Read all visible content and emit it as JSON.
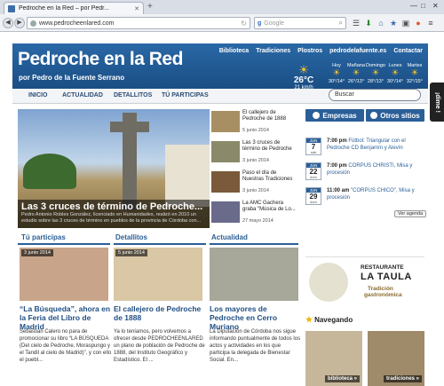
{
  "browser": {
    "tab_title": "Pedroche en la Red – por Pedr...",
    "url": "www.pedrocheenlared.com",
    "search_engine": "g",
    "search_placeholder": "Google"
  },
  "site": {
    "title": "Pedroche en la Red",
    "subtitle": "por Pedro de la Fuente Serrano",
    "top_links": [
      "Biblioteca",
      "Tradiciones",
      "Plostros",
      "pedrodelafuente.es",
      "Contactar"
    ],
    "weather": {
      "temp": "26°C",
      "wind": "21 km/h",
      "days": [
        {
          "day": "Hoy",
          "range": "30°/14°"
        },
        {
          "day": "Mañana",
          "range": "26°/13°"
        },
        {
          "day": "Domingo",
          "range": "28°/13°"
        },
        {
          "day": "Lunes",
          "range": "30°/14°"
        },
        {
          "day": "Martes",
          "range": "32°/15°"
        }
      ]
    },
    "menu": [
      "INICIO",
      "ACTUALIDAD",
      "DETALLITOS",
      "TÚ PARTICIPAS"
    ],
    "search_placeholder": "Buscar",
    "side_tab": "¡dime !"
  },
  "slider": {
    "title": "Las 3 cruces de término de Pedroche...",
    "desc": "Pedro Antonio Robles González, licenciado en Humanidades, realizó en 2010 un estudio sobre las 3 cruces de término en pueblos de la provincia de Córdoba con..."
  },
  "thumbs": [
    {
      "title": "El callejero de Pedroche de 1888",
      "date": "5 junio 2014"
    },
    {
      "title": "Las 3 cruces de término de Pedroche",
      "date": "3 junio 2014"
    },
    {
      "title": "Paso el día de Nuestras Tradiciones",
      "date": "3 junio 2014"
    },
    {
      "title": "La AMC Gachera graba \"Música de Lo...",
      "date": "27 mayo 2014"
    }
  ],
  "columns": [
    {
      "head": "Tú participas",
      "date": "3 junio 2014",
      "title": "“La Búsqueda”, ahora en la Feria del Libro de Madrid",
      "text": "Sebastián Calero no para de promocionar su libro “LA BÚSQUEDA (Del cielo de Pedroche, Moraspungo y el Tandil al cielo de Madrid)”, y con ello el puebl..."
    },
    {
      "head": "Detallitos",
      "date": "5 junio 2014",
      "title": "El callejero de Pedroche de 1888",
      "text": "Ya lo teníamos, pero volvemos a ofrecer desde PEDROCHEENLARED un plano de población de Pedroche de 1888, del Instituto Geográfico y Estadístico. El ..."
    },
    {
      "head": "Actualidad",
      "date": "",
      "title": "Los mayores de Pedroche en Cerro Muriano",
      "text": "La Diputación de Córdoba nos sigue informando puntualmente de todos los actos y actividades en los que participa la delegada de Bienestar Social. En..."
    }
  ],
  "right": {
    "btn_empresas": "Empresas",
    "btn_otros": "Otros sitios",
    "events": [
      {
        "month": "JUN",
        "day": "7",
        "weekday": "sáb",
        "time": "7:00 pm",
        "text": "Fútbol: Triangular con el Pedroche CD Benjamín y Alevín"
      },
      {
        "month": "JUN",
        "day": "22",
        "weekday": "dom",
        "time": "7:00 pm",
        "text": "CORPUS CHRISTI, Misa y procesión"
      },
      {
        "month": "JUN",
        "day": "29",
        "weekday": "dom",
        "time": "11:00 am",
        "text": "\"CORPUS CHICO\", Misa y procesión"
      }
    ],
    "ver_agenda": "Ver agenda",
    "ad": {
      "l1": "RESTAURANTE",
      "l2": "LA TAULA",
      "l3": "Tradición",
      "l4": "gastronómica"
    },
    "nav_head": "Navegando",
    "nav_items": [
      "biblioteca »",
      "tradiciones »"
    ]
  }
}
